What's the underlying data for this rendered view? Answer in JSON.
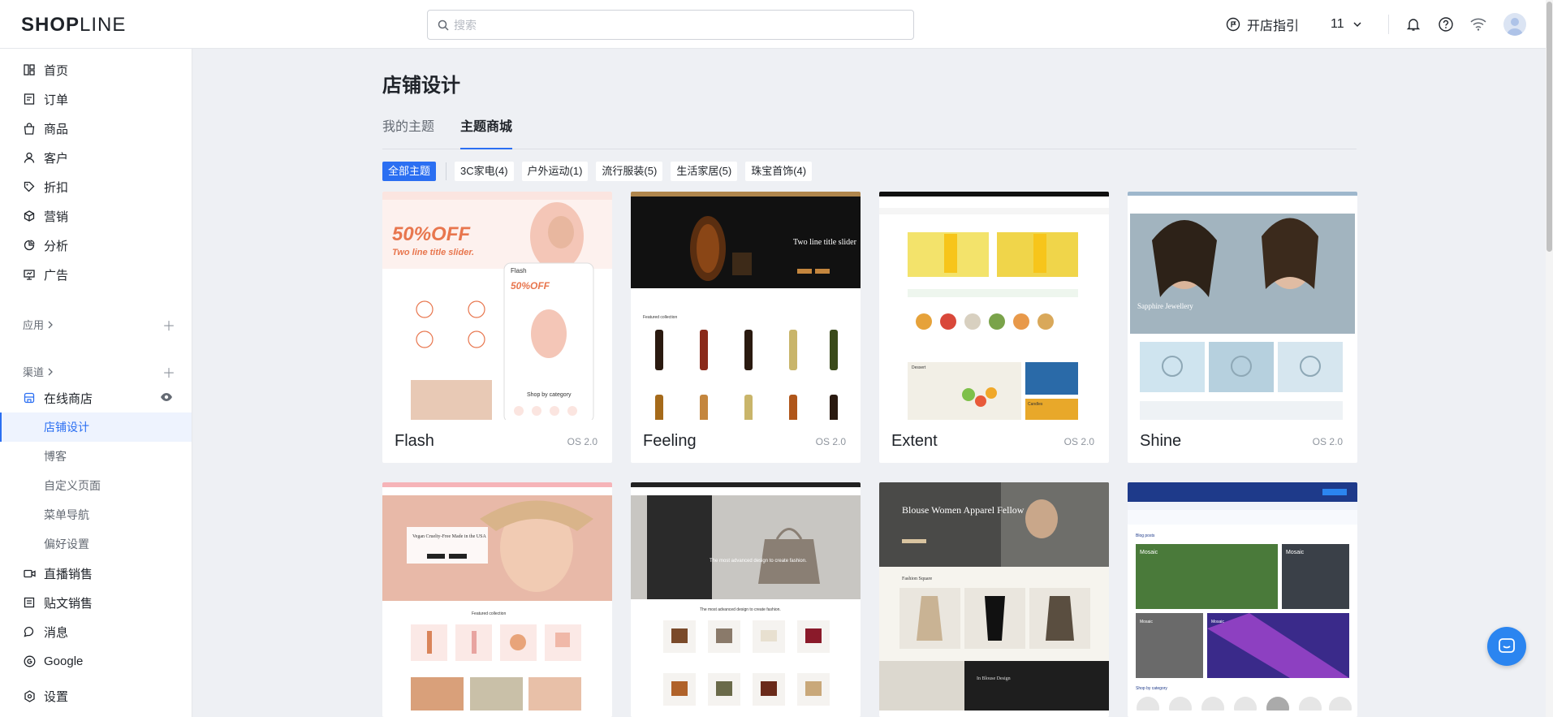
{
  "header": {
    "logo_bold": "SHOP",
    "logo_thin": "LINE",
    "search_placeholder": "搜索",
    "guide_label": "开店指引",
    "store_selector": "11",
    "icons": [
      "bell-icon",
      "help-icon",
      "wifi-icon",
      "avatar"
    ]
  },
  "sidebar": {
    "items": [
      {
        "label": "首页",
        "icon": "dashboard-icon"
      },
      {
        "label": "订单",
        "icon": "order-icon"
      },
      {
        "label": "商品",
        "icon": "bag-icon"
      },
      {
        "label": "客户",
        "icon": "user-icon"
      },
      {
        "label": "折扣",
        "icon": "tag-icon"
      },
      {
        "label": "营销",
        "icon": "box-icon"
      },
      {
        "label": "分析",
        "icon": "chart-icon"
      },
      {
        "label": "广告",
        "icon": "ad-icon"
      }
    ],
    "apps_label": "应用",
    "channels_label": "渠道",
    "online_store": "在线商店",
    "sub_items": [
      "店铺设计",
      "博客",
      "自定义页面",
      "菜单导航",
      "偏好设置"
    ],
    "bottom_items": [
      {
        "label": "直播销售",
        "icon": "video-icon"
      },
      {
        "label": "贴文销售",
        "icon": "post-icon"
      },
      {
        "label": "消息",
        "icon": "message-icon"
      },
      {
        "label": "Google",
        "icon": "google-icon"
      }
    ],
    "settings_label": "设置"
  },
  "main": {
    "title": "店铺设计",
    "tabs": [
      "我的主题",
      "主题商城"
    ],
    "active_tab": 1,
    "filters": [
      "全部主题",
      "3C家电(4)",
      "户外运动(1)",
      "流行服装(5)",
      "生活家居(5)",
      "珠宝首饰(4)"
    ],
    "themes": [
      {
        "name": "Flash",
        "os": "OS 2.0"
      },
      {
        "name": "Feeling",
        "os": "OS 2.0"
      },
      {
        "name": "Extent",
        "os": "OS 2.0"
      },
      {
        "name": "Shine",
        "os": "OS 2.0"
      },
      {
        "name": "",
        "os": ""
      },
      {
        "name": "",
        "os": ""
      },
      {
        "name": "",
        "os": ""
      },
      {
        "name": "",
        "os": ""
      }
    ],
    "previews": {
      "flash_headline": "50%OFF",
      "flash_sub": "Two line title slider.",
      "flash_cat": "Shop by category",
      "flash_mobile": "Flash",
      "feeling_headline": "Two line title slider",
      "feeling_collection": "Featured collection",
      "extent_dessert": "Dessert",
      "extent_candles": "Candles",
      "shine_title": "Sapphire Jewellery",
      "vegan_title": "Vegan Cruelty-Free Made in the USA",
      "vegan_collection": "Featured collection",
      "fashion_title": "The most advanced design to create fashion.",
      "blouse_title": "Blouse Women Apparel Fellow",
      "blouse_square": "Fashion Square",
      "blouse_design": "In Blouse Design",
      "mosaic_blog": "Blog posts",
      "mosaic_tile": "Mosaic",
      "mosaic_cat": "Shop by category"
    }
  },
  "colors": {
    "accent": "#2b6ff2",
    "background": "#eef0f4",
    "chat_button": "#2b85f0"
  }
}
